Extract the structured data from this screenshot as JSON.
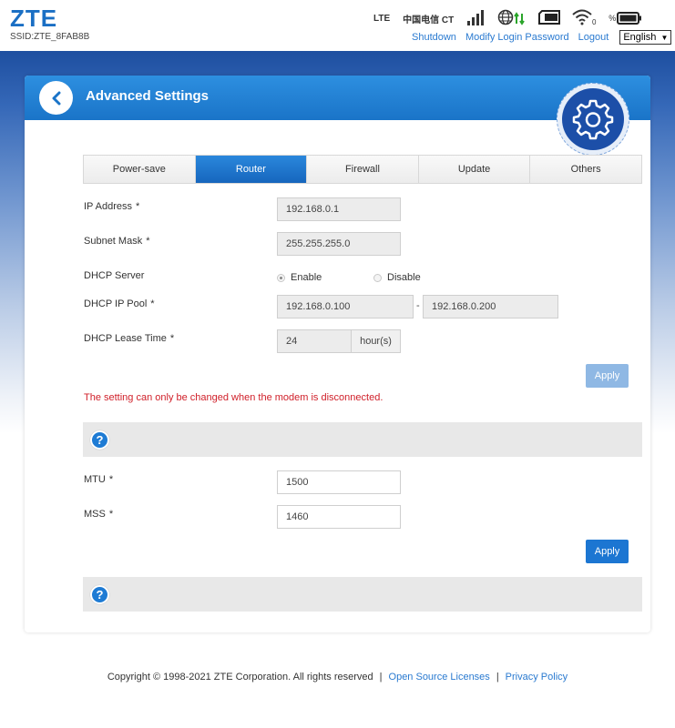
{
  "header": {
    "logo": "ZTE",
    "ssid": "SSID:ZTE_8FAB8B",
    "network_type": "LTE",
    "carrier": "中国电信 CT",
    "battery_label": "%",
    "links": {
      "shutdown": "Shutdown",
      "modify_password": "Modify Login Password",
      "logout": "Logout"
    },
    "language": "English",
    "language_arrow": "▼"
  },
  "panel": {
    "title": "Advanced Settings",
    "tabs": [
      {
        "label": "Power-save",
        "active": false
      },
      {
        "label": "Router",
        "active": true
      },
      {
        "label": "Firewall",
        "active": false
      },
      {
        "label": "Update",
        "active": false
      },
      {
        "label": "Others",
        "active": false
      }
    ]
  },
  "router_form": {
    "ip_address": {
      "label": "IP Address",
      "required": "*",
      "value": "192.168.0.1"
    },
    "subnet_mask": {
      "label": "Subnet Mask",
      "required": "*",
      "value": "255.255.255.0"
    },
    "dhcp_server": {
      "label": "DHCP Server",
      "enable": "Enable",
      "disable": "Disable",
      "selected": "Enable"
    },
    "dhcp_ip_pool": {
      "label": "DHCP IP Pool",
      "required": "*",
      "start": "192.168.0.100",
      "separator": "-",
      "end": "192.168.0.200"
    },
    "dhcp_lease_time": {
      "label": "DHCP Lease Time",
      "required": "*",
      "value": "24",
      "unit": "hour(s)"
    },
    "apply": "Apply",
    "notice": "The setting can only be changed when the modem is disconnected."
  },
  "mtu_form": {
    "mtu": {
      "label": "MTU",
      "required": "*",
      "value": "1500"
    },
    "mss": {
      "label": "MSS",
      "required": "*",
      "value": "1460"
    },
    "apply": "Apply"
  },
  "help_icon_glyph": "?",
  "footer": {
    "copyright": "Copyright © 1998-2021 ZTE Corporation. All rights reserved",
    "sep": "|",
    "open_source": "Open Source Licenses",
    "privacy": "Privacy Policy"
  },
  "colors": {
    "accent": "#1c76d2",
    "header_blue": "#1e4fa0",
    "notice_red": "#d0202a",
    "link_blue": "#2a7ad0"
  }
}
